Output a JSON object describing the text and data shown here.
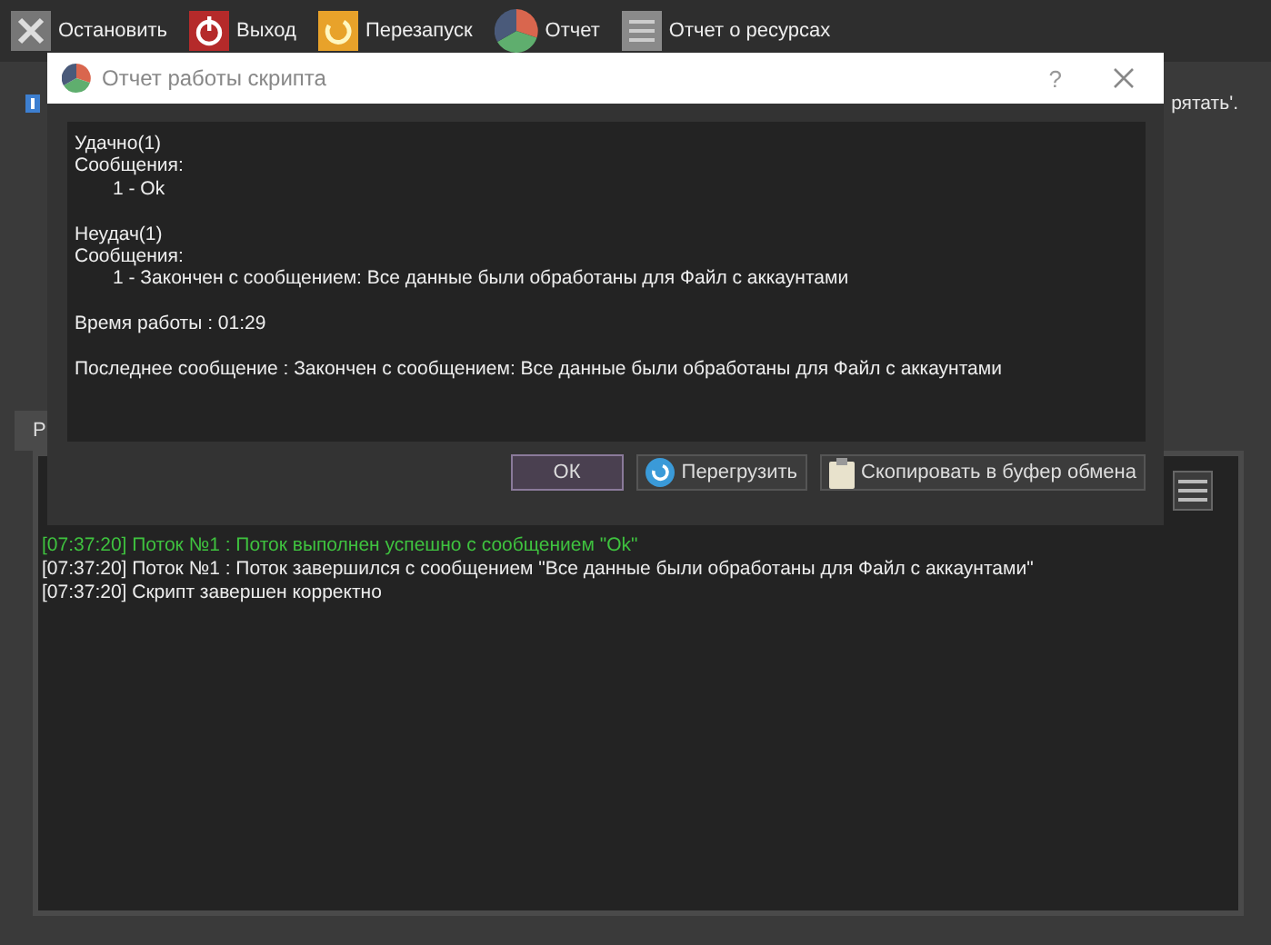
{
  "toolbar": [
    {
      "kind": "stop",
      "label": "Остановить"
    },
    {
      "kind": "exit",
      "label": "Выход"
    },
    {
      "kind": "restart",
      "label": "Перезапуск"
    },
    {
      "kind": "report",
      "label": "Отчет"
    },
    {
      "kind": "resources",
      "label": "Отчет о ресурсах"
    }
  ],
  "info_text": "рятать'.",
  "tab": {
    "label": "Р"
  },
  "log": [
    {
      "kind": "success",
      "text": "[07:37:20] Поток №1 : Поток выполнен успешно с сообщением \"Ok\""
    },
    {
      "kind": "info",
      "text": "[07:37:20] Поток №1 : Поток завершился с сообщением \"Все данные были обработаны для Файл с аккаунтами\""
    },
    {
      "kind": "info",
      "text": "[07:37:20] Скрипт завершен корректно"
    }
  ],
  "dialog": {
    "title": "Отчет работы скрипта",
    "help": "?",
    "report_blocks": [
      [
        {
          "text": "Удачно(1)",
          "kind": "plain"
        },
        {
          "text": "Сообщения:",
          "kind": "plain"
        },
        {
          "text": "1 - Ok",
          "kind": "indented"
        }
      ],
      [
        {
          "text": "Неудач(1)",
          "kind": "plain"
        },
        {
          "text": "Сообщения:",
          "kind": "plain"
        },
        {
          "text": "1 - Закончен с сообщением: Все данные были обработаны для Файл с аккаунтами",
          "kind": "indented"
        }
      ],
      [
        {
          "text": "Время работы : 01:29",
          "kind": "plain"
        }
      ],
      [
        {
          "text": "Последнее сообщение : Закончен с сообщением: Все данные были обработаны для Файл с аккаунтами",
          "kind": "plain"
        }
      ]
    ],
    "buttons": [
      {
        "kind": "ok",
        "label": "ОК"
      },
      {
        "kind": "reload",
        "label": "Перегрузить"
      },
      {
        "kind": "copy",
        "label": "Скопировать в буфер обмена"
      }
    ]
  }
}
